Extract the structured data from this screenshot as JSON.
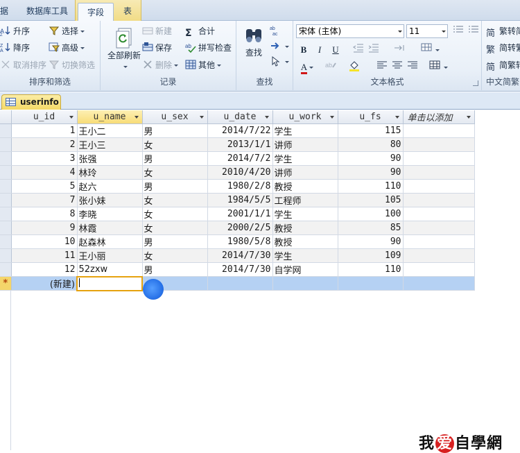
{
  "tabs": {
    "data": "据",
    "db_tools": "数据库工具",
    "field": "字段",
    "table": "表"
  },
  "ribbon": {
    "sort_filter": {
      "ascending": "升序",
      "descending": "降序",
      "clear_sort": "取消排序",
      "selection": "选择",
      "advanced": "高级",
      "toggle_filter": "切换筛选",
      "label": "排序和筛选"
    },
    "records": {
      "refresh_all": "全部刷新",
      "new": "新建",
      "save": "保存",
      "delete": "删除",
      "totals": "合计",
      "spelling": "拼写检查",
      "more": "其他",
      "label": "记录"
    },
    "find": {
      "find": "查找",
      "label": "查找"
    },
    "text_format": {
      "font": "宋体 (主体)",
      "size": "11",
      "label": "文本格式"
    },
    "chinese": {
      "to_traditional": "繁转简",
      "to_simplified": "简转繁",
      "convert": "简繁转换",
      "label": "中文简繁"
    }
  },
  "document_tab": "userinfo",
  "columns": [
    "u_id",
    "u_name",
    "u_sex",
    "u_date",
    "u_work",
    "u_fs",
    "单击以添加"
  ],
  "rows": [
    [
      "1",
      "王小二",
      "男",
      "2014/7/22",
      "学生",
      "115"
    ],
    [
      "2",
      "王小三",
      "女",
      "2013/1/1",
      "讲师",
      "80"
    ],
    [
      "3",
      "张强",
      "男",
      "2014/7/2",
      "学生",
      "90"
    ],
    [
      "4",
      "林玲",
      "女",
      "2010/4/20",
      "讲师",
      "90"
    ],
    [
      "5",
      "赵六",
      "男",
      "1980/2/8",
      "教授",
      "110"
    ],
    [
      "7",
      "张小妹",
      "女",
      "1984/5/5",
      "工程师",
      "105"
    ],
    [
      "8",
      "李晓",
      "女",
      "2001/1/1",
      "学生",
      "100"
    ],
    [
      "9",
      "林霞",
      "女",
      "2000/2/5",
      "教授",
      "85"
    ],
    [
      "10",
      "赵森林",
      "男",
      "1980/5/8",
      "教授",
      "90"
    ],
    [
      "11",
      "王小丽",
      "女",
      "2014/7/30",
      "学生",
      "109"
    ],
    [
      "12",
      "52zxw",
      "男",
      "2014/7/30",
      "自学网",
      "110"
    ]
  ],
  "new_row": {
    "marker": "*",
    "label": "(新建)"
  },
  "watermark": {
    "pre": "我",
    "badge": "爱",
    "post": "自學網"
  }
}
